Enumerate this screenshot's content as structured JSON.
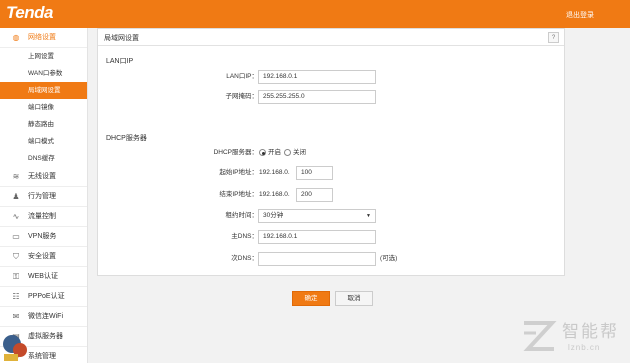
{
  "header": {
    "brand": "Tenda",
    "logout_label": "退出登录"
  },
  "sidebar": {
    "group": {
      "label": "网络设置",
      "icon": "globe-icon"
    },
    "subitems": [
      {
        "label": "上网设置",
        "active": false
      },
      {
        "label": "WAN口参数",
        "active": false
      },
      {
        "label": "局域网设置",
        "active": true
      },
      {
        "label": "端口镜像",
        "active": false
      },
      {
        "label": "静态路由",
        "active": false
      },
      {
        "label": "端口模式",
        "active": false
      },
      {
        "label": "DNS缓存",
        "active": false
      }
    ],
    "items": [
      {
        "label": "无线设置",
        "icon": "wifi-icon"
      },
      {
        "label": "行为管理",
        "icon": "user-manage-icon"
      },
      {
        "label": "流量控制",
        "icon": "traffic-icon"
      },
      {
        "label": "VPN服务",
        "icon": "vpn-icon"
      },
      {
        "label": "安全设置",
        "icon": "shield-icon"
      },
      {
        "label": "WEB认证",
        "icon": "web-auth-icon"
      },
      {
        "label": "PPPoE认证",
        "icon": "pppoe-icon"
      },
      {
        "label": "微信连WiFi",
        "icon": "wechat-icon"
      },
      {
        "label": "虚拟服务器",
        "icon": "server-icon"
      },
      {
        "label": "系统管理",
        "icon": "system-icon"
      }
    ]
  },
  "panel": {
    "title": "局域网设置",
    "help_label": "?",
    "lan": {
      "section_title": "LAN口IP",
      "ip_label": "LAN口IP：",
      "ip_value": "192.168.0.1",
      "mask_label": "子网掩码：",
      "mask_value": "255.255.255.0"
    },
    "dhcp": {
      "section_title": "DHCP服务器",
      "server_label": "DHCP服务器：",
      "on_label": "开启",
      "off_label": "关闭",
      "start_label": "起始IP地址：",
      "start_prefix": "192.168.0.",
      "start_value": "100",
      "end_label": "结束IP地址：",
      "end_prefix": "192.168.0.",
      "end_value": "200",
      "lease_label": "租约时间：",
      "lease_value": "30分钟",
      "dns1_label": "主DNS：",
      "dns1_value": "192.168.0.1",
      "dns2_label": "次DNS：",
      "dns2_value": "",
      "optional_note": "(可选)"
    }
  },
  "actions": {
    "ok_label": "确定",
    "cancel_label": "取消"
  },
  "watermark": {
    "text": "智能帮",
    "url": "lznb.cn"
  },
  "colors": {
    "accent": "#f07a14"
  }
}
